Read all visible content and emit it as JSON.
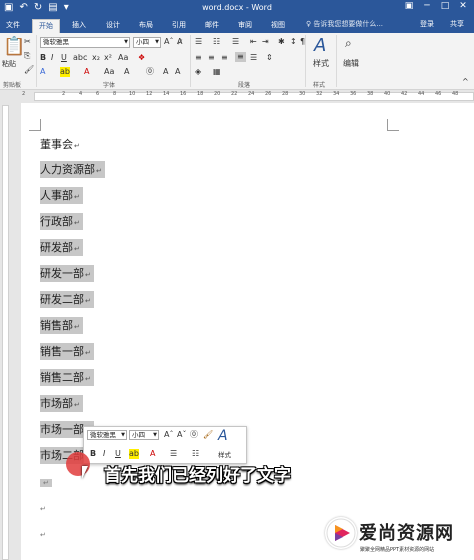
{
  "window": {
    "title": "word.docx - Word"
  },
  "tabs": [
    "文件",
    "开始",
    "插入",
    "设计",
    "布局",
    "引用",
    "邮件",
    "审阅",
    "视图"
  ],
  "tell_me": "♀ 告诉我您想要做什么...",
  "login": "登录",
  "share": "共享",
  "ribbon": {
    "paste_label": "粘贴",
    "font_name": "微软雅黑",
    "font_size": "小四",
    "groups": {
      "clipboard": "剪贴板",
      "font": "字体",
      "paragraph": "段落",
      "styles": "样式",
      "editing": "编辑"
    },
    "styles_label": "样式",
    "editing_label": "编辑"
  },
  "ruler_marks": [
    "2",
    "2",
    "4",
    "6",
    "8",
    "10",
    "12",
    "14",
    "16",
    "18",
    "20",
    "22",
    "24",
    "26",
    "28",
    "30",
    "32",
    "34",
    "36",
    "38",
    "40",
    "42",
    "44",
    "46",
    "48"
  ],
  "document": {
    "lines": [
      {
        "text": "董事会",
        "selected": false
      },
      {
        "text": "人力资源部",
        "selected": true
      },
      {
        "text": "人事部",
        "selected": true
      },
      {
        "text": "行政部",
        "selected": true
      },
      {
        "text": "研发部",
        "selected": true
      },
      {
        "text": "研发一部",
        "selected": true
      },
      {
        "text": "研发二部",
        "selected": true
      },
      {
        "text": "销售部",
        "selected": true
      },
      {
        "text": "销售一部",
        "selected": true
      },
      {
        "text": "销售二部",
        "selected": true
      },
      {
        "text": "市场部",
        "selected": true
      },
      {
        "text": "市场一部",
        "selected": true
      },
      {
        "text": "市场二部",
        "selected": true
      }
    ]
  },
  "mini_toolbar": {
    "font_name": "微软雅黑",
    "font_size": "小四",
    "styles_label": "样式"
  },
  "caption": "首先我们已经列好了文字",
  "watermark": {
    "title": "爱尚资源网",
    "subtitle": "聚聚全网精品PPT素材资源的网站"
  }
}
